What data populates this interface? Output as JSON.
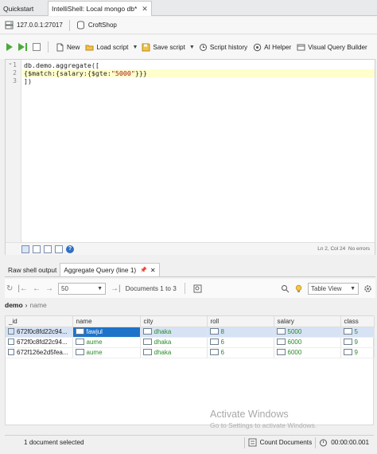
{
  "tabs": [
    {
      "label": "Quickstart",
      "active": false
    },
    {
      "label": "IntelliShell: Local mongo db*",
      "active": true
    }
  ],
  "connection": {
    "host": "127.0.0.1:27017",
    "database": "CroftShop"
  },
  "toolbar": {
    "new_label": "New",
    "load_label": "Load script",
    "save_label": "Save script",
    "history_label": "Script history",
    "ai_label": "AI Helper",
    "vqb_label": "Visual Query Builder"
  },
  "editor": {
    "line_numbers": [
      "1",
      "2",
      "3"
    ],
    "line1": "db.demo.aggregate([",
    "line2_pre": "{$match:{salary:{$gte:",
    "line2_str": "\"5000\"",
    "line2_post": "}}}",
    "line3": "])",
    "cursor_position": "Ln 2, Col 24",
    "error_status": "No errors"
  },
  "result_tabs": [
    {
      "label": "Raw shell output",
      "active": false
    },
    {
      "label": "Aggregate Query (line 1)",
      "active": true
    }
  ],
  "results_nav": {
    "page_size": "50",
    "range_text": "Documents 1 to 3",
    "view_mode": "Table View"
  },
  "breadcrumb": {
    "collection": "demo",
    "field": "name"
  },
  "grid": {
    "columns": [
      "_id",
      "name",
      "city",
      "roll",
      "salary",
      "class"
    ],
    "rows": [
      {
        "id": "672f0c8fd22c94...",
        "name": "fawjul",
        "city": "dhaka",
        "roll": "8",
        "salary": "5000",
        "class": "5"
      },
      {
        "id": "672f0c8fd22c94...",
        "name": "aume",
        "city": "dhaka",
        "roll": "6",
        "salary": "6000",
        "class": "9"
      },
      {
        "id": "672f126e2d5fea...",
        "name": "aume",
        "city": "dhaka",
        "roll": "6",
        "salary": "6000",
        "class": "9"
      }
    ]
  },
  "watermark": {
    "title": "Activate Windows",
    "subtitle": "Go to Settings to activate Windows."
  },
  "statusbar": {
    "selection": "1 document selected",
    "count_label": "Count Documents",
    "elapsed": "00:00:00.001"
  },
  "colors": {
    "accent": "#1e73c9",
    "run_green": "#4caa3a",
    "value_green": "#2b8a2b"
  }
}
